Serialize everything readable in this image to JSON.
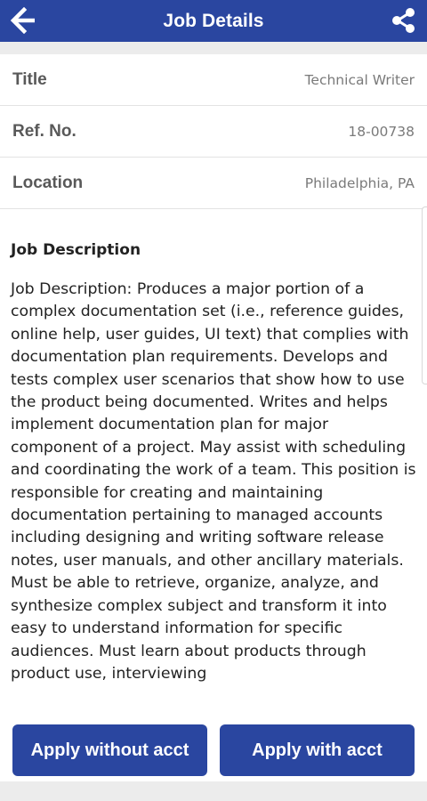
{
  "app_bar": {
    "title": "Job Details",
    "back_icon": "arrow-left-icon",
    "share_icon": "share-icon",
    "color": "#2a46a0"
  },
  "fields": [
    {
      "label": "Title",
      "value": "Technical Writer"
    },
    {
      "label": "Ref. No.",
      "value": "18-00738"
    },
    {
      "label": "Location",
      "value": "Philadelphia, PA"
    }
  ],
  "description": {
    "heading": "Job Description",
    "body": "Job Description: Produces a major portion of a complex documentation set (i.e., reference guides, online help, user guides, UI text) that complies with documentation plan requirements. Develops and tests complex user scenarios that show how to use the product being documented. Writes and helps implement documentation plan for major component of a project. May assist with scheduling and coordinating the work of a team. This position is responsible for creating and maintaining documentation pertaining to managed accounts including designing and writing software release notes, user manuals, and other ancillary materials. Must be able to retrieve, organize, analyze, and synthesize complex subject and transform it into easy to understand information for specific audiences. Must learn about products through product use, interviewing"
  },
  "actions": {
    "apply_without": "Apply without acct",
    "apply_with": "Apply with acct"
  }
}
